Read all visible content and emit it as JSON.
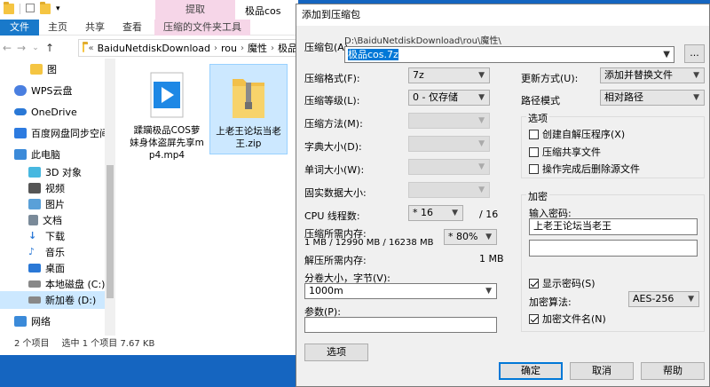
{
  "explorer": {
    "window_title": "极品cos",
    "context_tab": "提取",
    "ribbon_tabs": [
      "文件",
      "主页",
      "共享",
      "查看",
      "压缩的文件夹工具"
    ],
    "breadcrumb": [
      "BaiduNetdiskDownload",
      "rou",
      "魔性",
      "极品"
    ],
    "nav_items": [
      {
        "label": "图",
        "icon": "folder-icon",
        "color": "#f5c542"
      },
      {
        "label": "WPS云盘",
        "icon": "cloud-icon",
        "color": "#4a7fe0"
      },
      {
        "label": "OneDrive",
        "icon": "cloud-icon",
        "color": "#2a78d6"
      },
      {
        "label": "百度网盘同步空间",
        "icon": "baidu-sync-icon",
        "color": "#2d7be0"
      },
      {
        "label": "此电脑",
        "icon": "computer-icon",
        "color": "#3b8ad9"
      },
      {
        "label": "3D 对象",
        "icon": "cube-icon",
        "color": "#47b8e0"
      },
      {
        "label": "视频",
        "icon": "video-icon",
        "color": "#555"
      },
      {
        "label": "图片",
        "icon": "picture-icon",
        "color": "#5aa0d8"
      },
      {
        "label": "文档",
        "icon": "document-icon",
        "color": "#7a8a99"
      },
      {
        "label": "下载",
        "icon": "download-icon",
        "color": "#2a78d6"
      },
      {
        "label": "音乐",
        "icon": "music-icon",
        "color": "#2a78d6"
      },
      {
        "label": "桌面",
        "icon": "desktop-icon",
        "color": "#2a78d6"
      },
      {
        "label": "本地磁盘 (C:)",
        "icon": "drive-icon",
        "color": "#888"
      },
      {
        "label": "新加卷 (D:)",
        "icon": "drive-icon",
        "color": "#888"
      },
      {
        "label": "网络",
        "icon": "network-icon",
        "color": "#3b8ad9"
      }
    ],
    "files": [
      {
        "name": "蹂躏极品COS萝妹身体盗屏先享mp4.mp4",
        "icon": "video-file-icon"
      },
      {
        "name": "上老王论坛当老王.zip",
        "icon": "zip-file-icon"
      }
    ],
    "status": {
      "count": "2 个项目",
      "selected": "选中 1 个项目  7.67 KB"
    }
  },
  "dialog": {
    "title": "添加到压缩包",
    "archive_label": "压缩包(A)",
    "archive_path": "D:\\BaiduNetdiskDownload\\rou\\魔性\\",
    "archive_name": "极品cos.7z",
    "browse_label": "...",
    "format_label": "压缩格式(F):",
    "format_value": "7z",
    "level_label": "压缩等级(L):",
    "level_value": "0 - 仅存储",
    "method_label": "压缩方法(M):",
    "dict_label": "字典大小(D):",
    "word_label": "单词大小(W):",
    "solid_label": "固实数据大小:",
    "threads_label": "CPU 线程数:",
    "threads_value": "* 16",
    "threads_max": "/ 16",
    "memory_label": "压缩所需内存:",
    "memory_value": "1 MB / 12990 MB / 16238 MB",
    "memory_percent": "* 80%",
    "decomp_label": "解压所需内存:",
    "decomp_value": "1 MB",
    "split_label": "分卷大小，字节(V):",
    "split_value": "1000m",
    "params_label": "参数(P):",
    "params_value": "",
    "options_button": "选项",
    "update_label": "更新方式(U):",
    "update_value": "添加并替换文件",
    "pathmode_label": "路径模式",
    "pathmode_value": "相对路径",
    "options_group": "选项",
    "opt_sfx": "创建自解压程序(X)",
    "opt_shared": "压缩共享文件",
    "opt_delete": "操作完成后删除源文件",
    "encrypt_group": "加密",
    "password_label": "输入密码:",
    "password_value": "上老王论坛当老王",
    "show_password": "显示密码(S)",
    "enc_method_label": "加密算法:",
    "enc_method_value": "AES-256",
    "encrypt_names": "加密文件名(N)",
    "ok": "确定",
    "cancel": "取消",
    "help": "帮助"
  }
}
